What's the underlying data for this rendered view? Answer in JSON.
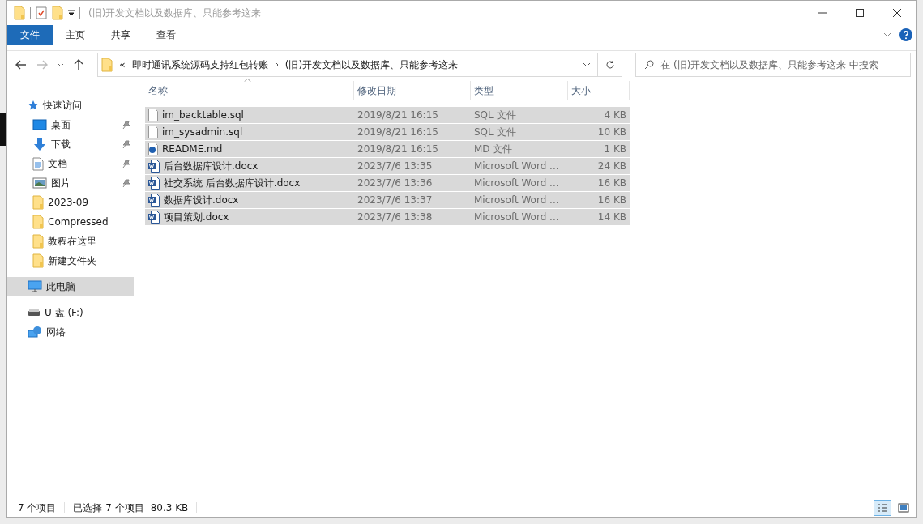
{
  "window": {
    "title": "(旧)开发文档以及数据库、只能参考这来"
  },
  "ribbon_tabs": [
    {
      "label": "文件",
      "selected": true
    },
    {
      "label": "主页",
      "selected": false
    },
    {
      "label": "共享",
      "selected": false
    },
    {
      "label": "查看",
      "selected": false
    }
  ],
  "address_bar": {
    "overflow": "«",
    "path": [
      "即时通讯系统源码支持红包转账",
      "(旧)开发文档以及数据库、只能参考这来"
    ]
  },
  "search": {
    "placeholder": "在 (旧)开发文档以及数据库、只能参考这来 中搜索"
  },
  "sidebar": {
    "items": [
      {
        "label": "快速访问",
        "kind": "star",
        "selected": false,
        "children": [
          {
            "label": "桌面",
            "kind": "desktop",
            "pinned": true,
            "selected": false
          },
          {
            "label": "下载",
            "kind": "download",
            "pinned": true,
            "selected": false
          },
          {
            "label": "文档",
            "kind": "document",
            "pinned": true,
            "selected": false
          },
          {
            "label": "图片",
            "kind": "picture",
            "pinned": true,
            "selected": false
          },
          {
            "label": "2023-09",
            "kind": "folder",
            "pinned": false,
            "selected": false
          },
          {
            "label": "Compressed",
            "kind": "folder",
            "pinned": false,
            "selected": false
          },
          {
            "label": "教程在这里",
            "kind": "folder",
            "pinned": false,
            "selected": false
          },
          {
            "label": "新建文件夹",
            "kind": "folder",
            "pinned": false,
            "selected": false
          }
        ]
      },
      {
        "label": "此电脑",
        "kind": "pc",
        "selected": true
      },
      {
        "label": "U 盘 (F:)",
        "kind": "drive",
        "selected": false
      },
      {
        "label": "网络",
        "kind": "network",
        "selected": false
      }
    ]
  },
  "table": {
    "columns": [
      {
        "label": "名称"
      },
      {
        "label": "修改日期"
      },
      {
        "label": "类型"
      },
      {
        "label": "大小"
      }
    ],
    "rows": [
      {
        "name": "im_backtable.sql",
        "date": "2019/8/21 16:15",
        "type": "SQL 文件",
        "size": "4 KB",
        "kind": "file",
        "selected": true
      },
      {
        "name": "im_sysadmin.sql",
        "date": "2019/8/21 16:15",
        "type": "SQL 文件",
        "size": "10 KB",
        "kind": "file",
        "selected": true
      },
      {
        "name": "README.md",
        "date": "2019/8/21 16:15",
        "type": "MD 文件",
        "size": "1 KB",
        "kind": "md",
        "selected": true
      },
      {
        "name": "后台数据库设计.docx",
        "date": "2023/7/6 13:35",
        "type": "Microsoft Word ...",
        "size": "24 KB",
        "kind": "word",
        "selected": true
      },
      {
        "name": "社交系统 后台数据库设计.docx",
        "date": "2023/7/6 13:36",
        "type": "Microsoft Word ...",
        "size": "16 KB",
        "kind": "word",
        "selected": true
      },
      {
        "name": "数据库设计.docx",
        "date": "2023/7/6 13:37",
        "type": "Microsoft Word ...",
        "size": "16 KB",
        "kind": "word",
        "selected": true
      },
      {
        "name": "项目策划.docx",
        "date": "2023/7/6 13:38",
        "type": "Microsoft Word ...",
        "size": "14 KB",
        "kind": "word",
        "selected": true
      }
    ]
  },
  "status_bar": {
    "item_count": "7 个项目",
    "selection": "已选择 7 个项目",
    "selection_size": "80.3 KB",
    "views": [
      {
        "kind": "details",
        "selected": true
      },
      {
        "kind": "large",
        "selected": false
      }
    ]
  }
}
